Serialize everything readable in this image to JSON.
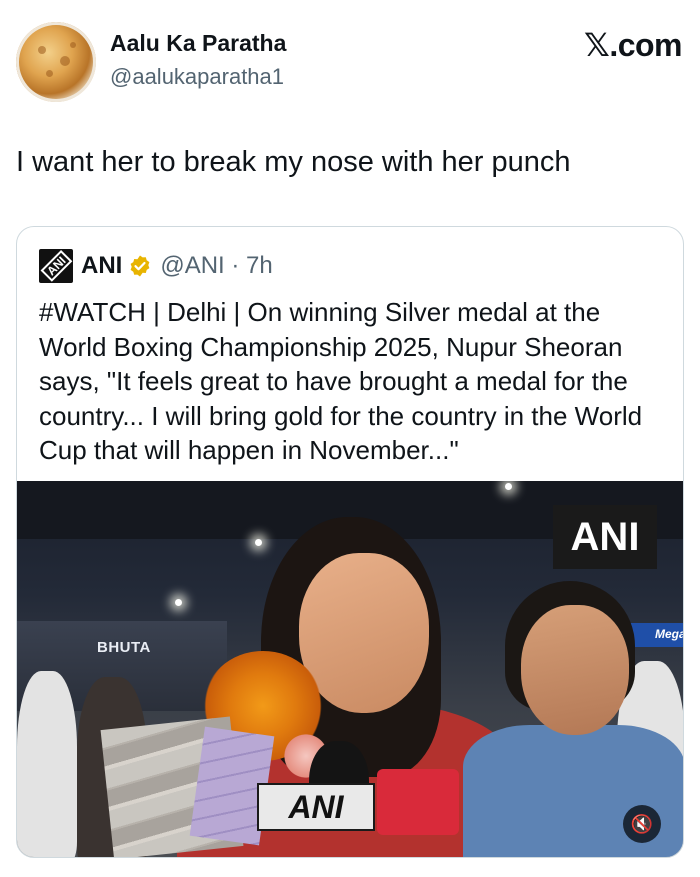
{
  "author": {
    "name": "Aalu Ka Paratha",
    "handle": "@aalukaparatha1"
  },
  "watermark": "𝕏.com",
  "tweet_text": "I want her to break my nose with her punch",
  "quoted": {
    "logo_text": "ANI",
    "name": "ANI",
    "handle_time": "@ANI · 7h",
    "text": "#WATCH | Delhi | On winning Silver medal at the World Boxing Championship 2025, Nupur Sheoran says, \"It feels great to have brought a medal for the country... I will bring gold for the country in the World Cup that will happen in November...\"",
    "media": {
      "ani_overlay": "ANI",
      "sign_bhutan": "BHUTA",
      "sign_mega": "Mega",
      "mic_label": "ANI",
      "mute_icon": "mute-icon"
    }
  }
}
